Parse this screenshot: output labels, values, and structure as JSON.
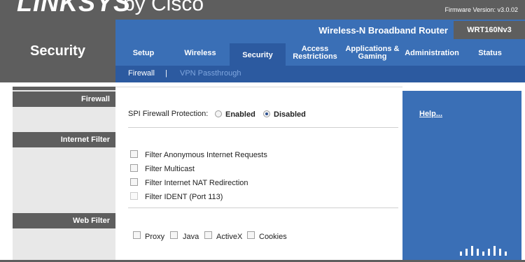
{
  "header": {
    "logo_main": "LINKSYS",
    "logo_sub": "by Cisco",
    "firmware": "Firmware Version: v3.0.02"
  },
  "page_title": "Security",
  "product": {
    "name": "Wireless-N Broadband Router",
    "model": "WRT160Nv3"
  },
  "tabs": [
    "Setup",
    "Wireless",
    "Security",
    "Access Restrictions",
    "Applications & Gaming",
    "Administration",
    "Status"
  ],
  "active_tab": "Security",
  "subtabs": {
    "firewall": "Firewall",
    "separator": "|",
    "vpn": "VPN Passthrough"
  },
  "sections": {
    "firewall": "Firewall",
    "internet_filter": "Internet Filter",
    "web_filter": "Web Filter"
  },
  "spi": {
    "label": "SPI Firewall Protection:",
    "enabled": "Enabled",
    "disabled": "Disabled",
    "selected": "Disabled"
  },
  "internet_filter": [
    "Filter Anonymous Internet Requests",
    "Filter Multicast",
    "Filter Internet NAT Redirection",
    "Filter IDENT (Port 113)"
  ],
  "web_filter": [
    "Proxy",
    "Java",
    "ActiveX",
    "Cookies"
  ],
  "help": "Help...",
  "colors": {
    "dark_gray": "#5e5e5e",
    "blue": "#3a6fb6",
    "dark_blue": "#2c5aa0"
  }
}
